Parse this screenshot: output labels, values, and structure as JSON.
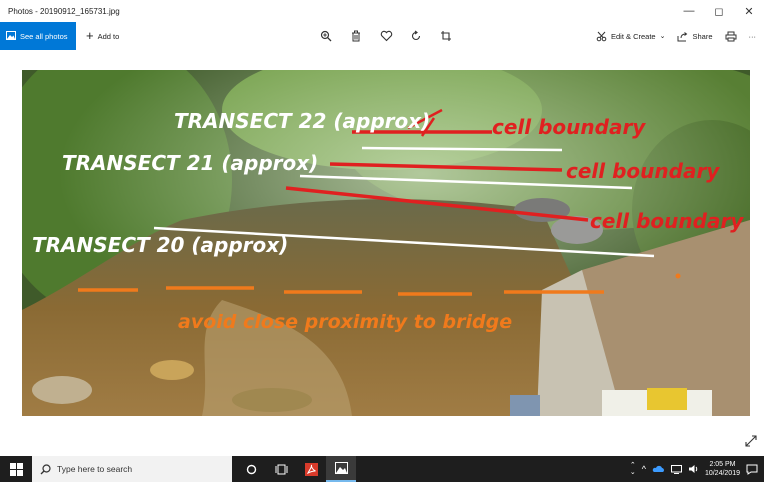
{
  "window": {
    "title": "Photos - 20190912_165731.jpg",
    "minimize": "—",
    "maximize": "◻",
    "close": "✕"
  },
  "toolbar": {
    "see_all": "See all photos",
    "add_to": "Add to",
    "edit_create": "Edit & Create",
    "share": "Share",
    "more": "···"
  },
  "photo": {
    "labels": {
      "transect_22": "TRANSECT 22 (approx)",
      "transect_21": "TRANSECT 21 (approx)",
      "transect_20": "TRANSECT 20 (approx)",
      "cell_boundary_1": "cell boundary",
      "cell_boundary_2": "cell boundary",
      "cell_boundary_3": "cell boundary",
      "avoid_note": "avoid close proximity to bridge"
    },
    "colors": {
      "transect": "#ffffff",
      "boundary": "#e02020",
      "note": "#f07a1c"
    }
  },
  "taskbar": {
    "search_placeholder": "Type here to search",
    "time": "2:05 PM",
    "date": "10/24/2019"
  }
}
